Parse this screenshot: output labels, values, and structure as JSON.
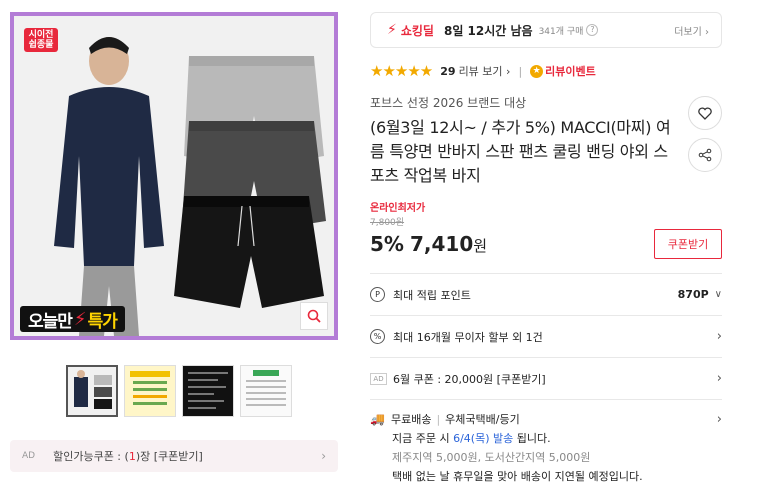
{
  "main_image": {
    "corner_badge": "시이전\n쉽종물",
    "promo": {
      "part1": "오늘만",
      "part2": "특가"
    }
  },
  "thumbnails_count": 4,
  "coupon_bar": {
    "ad": "AD",
    "label": "할인가능쿠폰 : (",
    "count": "1",
    "suffix": ")장 [쿠폰받기]"
  },
  "deal": {
    "label": "쇼킹딜",
    "time_left": "8일 12시간 남음",
    "purchases": "341개 구매",
    "more": "더보기"
  },
  "rating": {
    "stars": "★★★★★",
    "review_count": "29",
    "review_label": "리뷰 보기",
    "event": "리뷰이벤트"
  },
  "product": {
    "brand_award": "포브스 선정 2026 브랜드 대상",
    "title": "(6월3일 12시~ / 추가 5%) MACCI(마찌) 여름 특양면 반바지 스판 팬츠 쿨링 밴딩 야외 스포츠 작업복 바지"
  },
  "price": {
    "lowest_badge": "온라인최저가",
    "original": "7,800원",
    "discount": "5%",
    "amount": "7,410",
    "unit": "원",
    "coupon_button": "쿠폰받기"
  },
  "benefits": {
    "points_label": "최대 적립 포인트",
    "points_value": "870P",
    "installment_label": "최대 16개월 무이자 할부 외 1건",
    "coupon_ad": "AD",
    "coupon_label": "6월 쿠폰 : 20,000원 [쿠폰받기]"
  },
  "shipping": {
    "free": "무료배송",
    "method": "우체국택배/등기",
    "line1_a": "지금 주문 시 ",
    "line1_date": "6/4(목) 발송",
    "line1_b": " 됩니다.",
    "line2": "제주지역 5,000원, 도서산간지역 5,000원",
    "line3": "택배 없는 날 휴무일을 맞아 배송이 지연될 예정입니다."
  }
}
